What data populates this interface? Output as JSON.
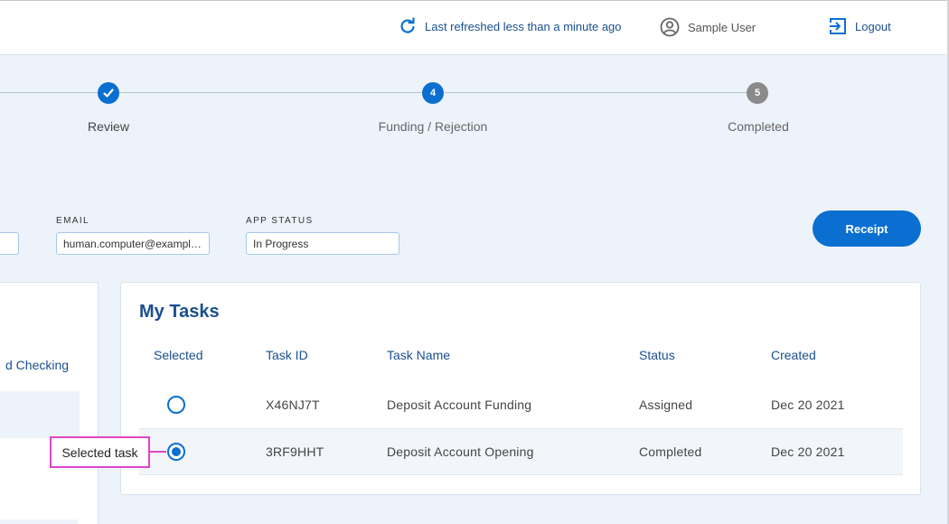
{
  "header": {
    "refresh_text": "Last refreshed less than a minute ago",
    "user_name": "Sample User",
    "logout_label": "Logout"
  },
  "stepper": {
    "steps": [
      {
        "label": "Review",
        "status": "done",
        "number": ""
      },
      {
        "label": "Funding / Rejection",
        "status": "active",
        "number": "4"
      },
      {
        "label": "Completed",
        "status": "future",
        "number": "5"
      }
    ]
  },
  "fields": {
    "email_label": "EMAIL",
    "email_value": "human.computer@example.com",
    "status_label": "APP STATUS",
    "status_value": "In Progress"
  },
  "receipt_label": "Receipt",
  "left_panel": {
    "text": "d Checking"
  },
  "tasks": {
    "title": "My Tasks",
    "headers": [
      "Selected",
      "Task ID",
      "Task Name",
      "Status",
      "Created"
    ],
    "rows": [
      {
        "selected": false,
        "task_id": "X46NJ7T",
        "task_name": "Deposit Account Funding",
        "status": "Assigned",
        "created": "Dec 20 2021"
      },
      {
        "selected": true,
        "task_id": "3RF9HHT",
        "task_name": "Deposit Account Opening",
        "status": "Completed",
        "created": "Dec 20 2021"
      }
    ]
  },
  "callout_label": "Selected task",
  "colors": {
    "accent": "#0a6fd1",
    "heading": "#1a4f8f",
    "callout": "#e046c8",
    "background": "#edf3fb"
  }
}
